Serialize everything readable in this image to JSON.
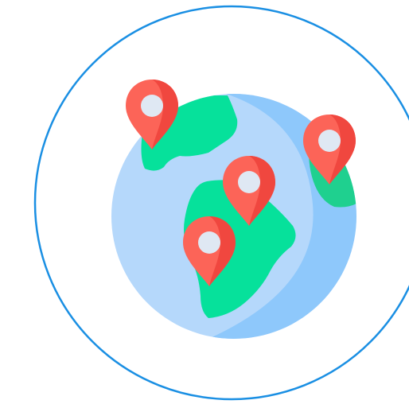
{
  "colors": {
    "ring": "#1a8fe3",
    "globe_light": "#b5d8fb",
    "globe_shade": "#8ec8fb",
    "land": "#06e19b",
    "land_shade": "#1fd08f",
    "pin": "#fc6458",
    "pin_shade": "#f0473f",
    "pin_dot": "#dfe8f3"
  },
  "icons": {
    "globe": "globe-icon",
    "pin": "map-pin-icon"
  }
}
